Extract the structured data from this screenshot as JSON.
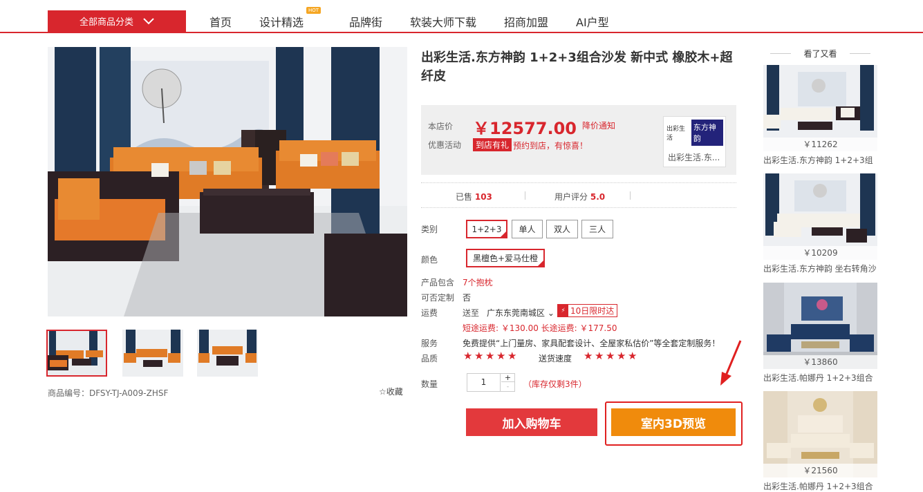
{
  "nav": {
    "category_label": "全部商品分类",
    "items": [
      "首页",
      "设计精选",
      "品牌街",
      "软装大师下载",
      "招商加盟",
      "AI户型"
    ],
    "hot_badge": "HOT"
  },
  "product": {
    "title": "出彩生活.东方神韵 1+2+3组合沙发 新中式 橡胶木+超纤皮",
    "code": "商品编号：DFSY-TJ-A009-ZHSF",
    "favorite": "收藏",
    "price_label": "本店价",
    "price": "￥12577.00",
    "price_alert": "降价通知",
    "promo_label": "优惠活动",
    "promo_tag": "到店有礼",
    "promo_text": "预约到店，有惊喜！",
    "brand_logo_small": "出彩生活",
    "brand_logo_big": "东方神韵",
    "brand_name": "出彩生活.东...",
    "sold_label": "已售",
    "sold_count": "103",
    "rating_label": "用户评分",
    "rating_value": "5.0",
    "category_label": "类别",
    "category_options": [
      "1+2+3",
      "单人",
      "双人",
      "三人"
    ],
    "color_label": "颜色",
    "color_option": "黑檀色+爱马仕橙",
    "includes_label": "产品包含",
    "includes_value": "7个抱枕",
    "custom_label": "可否定制",
    "custom_value": "否",
    "shipping_label": "运费",
    "ship_to": "送至",
    "ship_region": "广东东莞南城区",
    "ship_badge": "10日限时达",
    "ship_icon": "⚡",
    "ship_fees": "短途运费: ￥130.00 长途运费: ￥177.50",
    "service_label": "服务",
    "service_value": "免费提供“上门量房、家具配套设计、全屋家私估价”等全套定制服务！",
    "quality_label": "品质",
    "delivery_label": "送货速度",
    "quantity_label": "数量",
    "quantity": "1",
    "qty_plus": "+",
    "qty_minus": "-",
    "stock_note": "（库存仅剩3件）",
    "add_cart": "加入购物车",
    "preview_3d": "室内3D预览"
  },
  "sidebar": {
    "title": "看了又看",
    "items": [
      {
        "price": "￥11262",
        "name": "出彩生活.东方神韵 1+2+3组"
      },
      {
        "price": "￥10209",
        "name": "出彩生活.东方神韵 坐右转角沙"
      },
      {
        "price": "￥13860",
        "name": "出彩生活.帕娜丹 1+2+3组合"
      },
      {
        "price": "￥21560",
        "name": "出彩生活.帕娜丹 1+2+3组合"
      }
    ]
  },
  "colors": {
    "accent": "#d8262d",
    "orange": "#f08b0c",
    "cart": "#e3393c"
  }
}
